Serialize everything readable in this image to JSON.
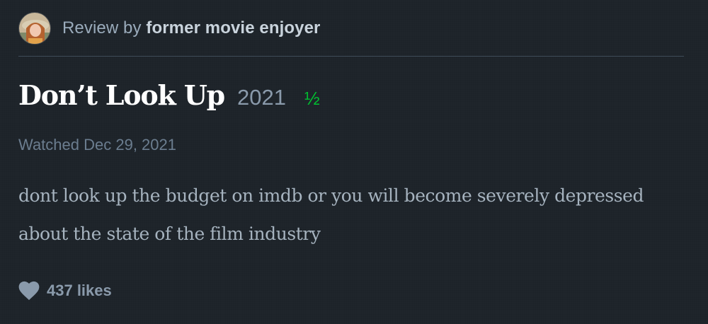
{
  "header": {
    "avatar_icon": "user-avatar-photo",
    "review_by_label": "Review by",
    "author_name": "former movie enjoyer"
  },
  "film": {
    "title": "Don’t Look Up",
    "year": "2021",
    "rating": "½"
  },
  "watched_text": "Watched Dec 29, 2021",
  "review_text": "dont look up the budget on imdb or you will become severely depressed about the state of the film industry",
  "likes": {
    "icon": "heart-icon",
    "label": "437 likes"
  },
  "colors": {
    "background": "#1d2329",
    "rating_green": "#00c030",
    "title_white": "#ffffff"
  }
}
